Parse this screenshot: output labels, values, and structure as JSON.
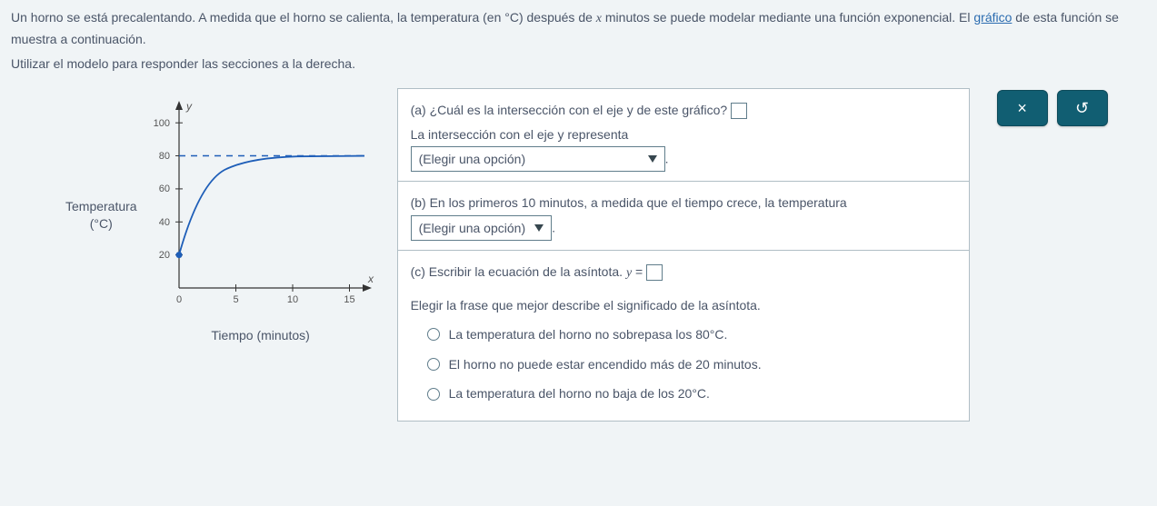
{
  "intro": {
    "line1_pre": "Un horno se está precalentando. A medida que el horno se calienta, la temperatura (en °C) después de ",
    "var": "x",
    "line1_post": " minutos se puede modelar mediante una función exponencial. El ",
    "link": "gráfico",
    "line1_end": " de esta función se muestra a continuación.",
    "line2": "Utilizar el modelo para responder las secciones a la derecha."
  },
  "chart": {
    "ylabel_line1": "Temperatura",
    "ylabel_line2": "(°C)",
    "xlabel": "Tiempo (minutos)",
    "y_axis_var": "y",
    "x_axis_var": "x",
    "y_ticks": [
      "20",
      "40",
      "60",
      "80",
      "100"
    ],
    "x_ticks": [
      "0",
      "5",
      "10",
      "15"
    ]
  },
  "chart_data": {
    "type": "line",
    "title": "",
    "xlabel": "Tiempo (minutos)",
    "ylabel": "Temperatura (°C)",
    "xlim": [
      0,
      16
    ],
    "ylim": [
      0,
      110
    ],
    "asymptote_y": 80,
    "series": [
      {
        "name": "temperatura",
        "x": [
          0,
          1,
          2,
          3,
          4,
          5,
          6,
          7,
          8,
          10,
          12,
          15
        ],
        "y": [
          20,
          44,
          58,
          67,
          72,
          75,
          77,
          78,
          79,
          79.5,
          79.8,
          80
        ]
      }
    ]
  },
  "questions": {
    "a": {
      "q": "(a) ¿Cuál es la intersección con el eje y de este gráfico? ",
      "line2": "La intersección con el eje y representa",
      "dropdown": "(Elegir una opción)",
      "suffix": "."
    },
    "b": {
      "pre": "(b) En los primeros 10 minutos, a medida que el tiempo crece, la temperatura ",
      "dropdown": "(Elegir una opción)",
      "suffix": "."
    },
    "c": {
      "eq_pre": "(c) Escribir la ecuación de la asíntota. ",
      "eq_var": "y",
      "eq_equals": " = ",
      "prompt": "Elegir la frase que mejor describe el significado de la asíntota.",
      "opt1": "La temperatura del horno no sobrepasa los 80°C.",
      "opt2": "El horno no puede estar encendido más de 20 minutos.",
      "opt3": "La temperatura del horno no baja de los 20°C."
    }
  },
  "buttons": {
    "close": "×",
    "reset": "↺"
  }
}
